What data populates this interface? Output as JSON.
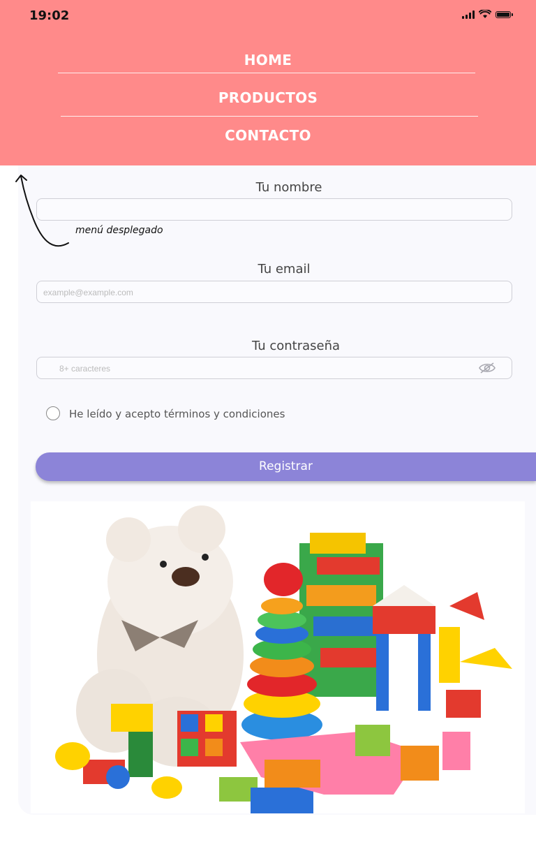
{
  "status_bar": {
    "time": "19:02"
  },
  "nav": {
    "items": [
      "HOME",
      "PRODUCTOS",
      "CONTACTO"
    ]
  },
  "annotation": "menú desplegado",
  "form": {
    "name_label": "Tu nombre",
    "name_value": "",
    "email_label": "Tu email",
    "email_placeholder": "example@example.com",
    "password_label": "Tu contraseña",
    "password_placeholder": "8+ caracteres",
    "terms_label": "He leído y acepto términos y condiciones",
    "terms_checked": false,
    "submit_label": "Registrar"
  },
  "icons": [
    "signal-icon",
    "wifi-icon",
    "battery-icon",
    "eye-off-icon",
    "arrow-icon"
  ],
  "colors": {
    "header": "#ff8a8a",
    "button": "#8c84d8",
    "card": "#f9f9fd"
  }
}
